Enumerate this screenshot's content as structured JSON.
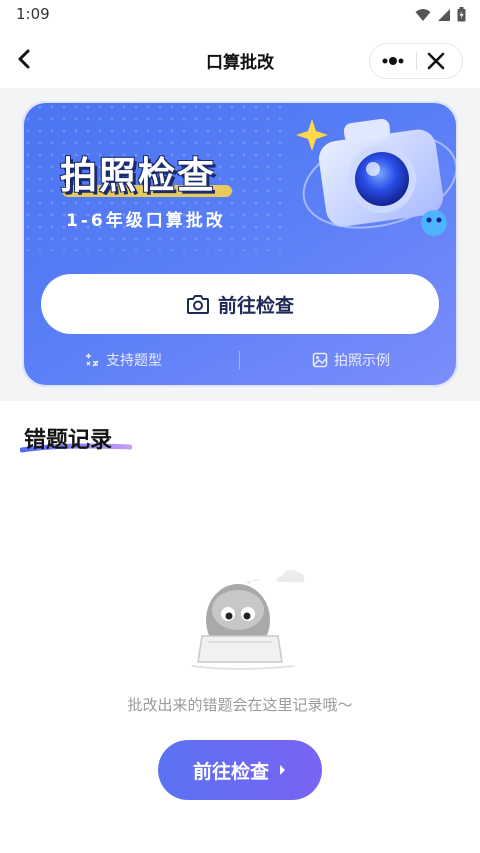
{
  "status_bar": {
    "time": "1:09",
    "icons": [
      "wifi-icon",
      "signal-icon",
      "battery-icon"
    ]
  },
  "nav": {
    "title": "口算批改",
    "back_icon": "back-chevron-icon",
    "more_icon": "more-dots-icon",
    "close_icon": "close-icon"
  },
  "banner": {
    "headline": "拍照检查",
    "subtitle": "1-6年级口算批改",
    "cta_label": "前往检查",
    "cta_icon": "camera-icon",
    "links": [
      {
        "label": "支持题型",
        "icon": "math-ops-icon"
      },
      {
        "label": "拍照示例",
        "icon": "image-icon"
      }
    ],
    "colors": {
      "card_start": "#4a74f2",
      "card_end": "#7c8dfb",
      "headline_stroke": "#1a2a6a"
    }
  },
  "section": {
    "title": "错题记录"
  },
  "empty_state": {
    "message": "批改出来的错题会在这里记录哦～",
    "button_label": "前往检查",
    "button_icon": "chevron-right-icon",
    "colors": {
      "button_start": "#5a72f4",
      "button_end": "#7a63f5"
    }
  }
}
